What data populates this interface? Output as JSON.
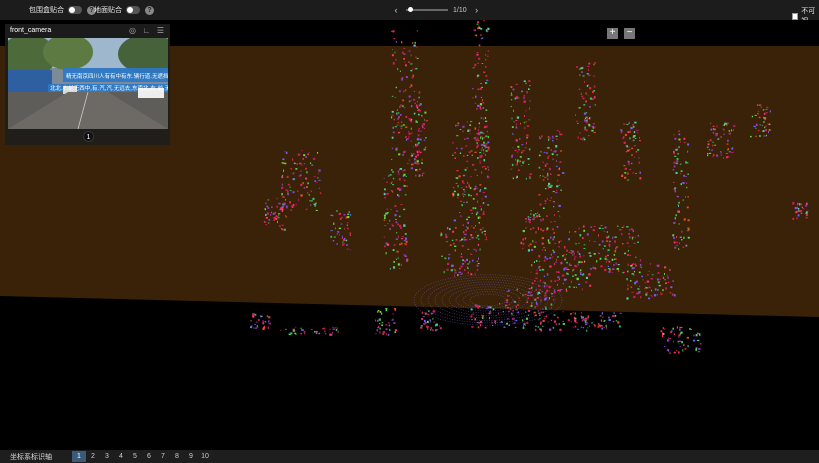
{
  "toolbar": {
    "toggle1_label": "包围盒贴合",
    "toggle2_label": "地面贴合",
    "help_glyph": "?",
    "prev_icon": "prev-arrow-icon",
    "next_icon": "next-arrow-icon",
    "frame_counter": "1/10",
    "frame_progress": 0.1,
    "invisible_label": "不可视"
  },
  "camera": {
    "title": "front_camera",
    "badge": "1",
    "banner_line1": "精无南京四川人有有中有东.辆行道.无遮挡,后,无远去",
    "banner_line2": "北北.右前无西中,有.汽,汽.无远去,东南北,右.前.无遮挡",
    "icons": [
      "target-icon",
      "ruler-icon",
      "menu-icon"
    ]
  },
  "zoom": {
    "in_label": "+",
    "out_label": "−"
  },
  "bottom": {
    "coord_label": "坐标系标识轴",
    "frames": [
      "1",
      "2",
      "3",
      "4",
      "5",
      "6",
      "7",
      "8",
      "9",
      "10"
    ],
    "active_frame": "1"
  },
  "colors": {
    "background_upper": "#3a2208",
    "background_lower": "#000000",
    "toolbar": "#1c1c1c",
    "active_frame": "#3a5a7a"
  }
}
